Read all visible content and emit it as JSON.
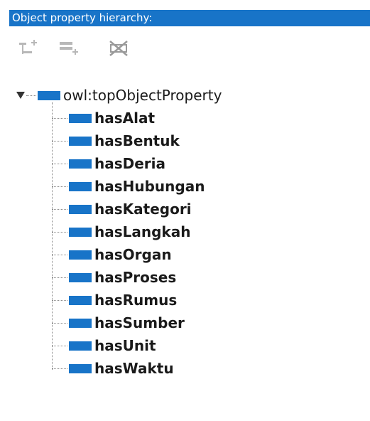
{
  "panel": {
    "title": "Object property hierarchy:"
  },
  "toolbar": {
    "buttons": [
      {
        "name": "add-sub-property",
        "icon": "add-subproperty-icon",
        "enabled": false
      },
      {
        "name": "add-sibling-property",
        "icon": "add-sibling-icon",
        "enabled": false
      },
      {
        "name": "delete-property",
        "icon": "delete-property-icon",
        "enabled": true
      }
    ]
  },
  "tree": {
    "root": {
      "label": "owl:topObjectProperty",
      "expanded": true
    },
    "children": [
      {
        "label": "hasAlat"
      },
      {
        "label": "hasBentuk"
      },
      {
        "label": "hasDeria"
      },
      {
        "label": "hasHubungan"
      },
      {
        "label": "hasKategori"
      },
      {
        "label": "hasLangkah"
      },
      {
        "label": "hasOrgan"
      },
      {
        "label": "hasProses"
      },
      {
        "label": "hasRumus"
      },
      {
        "label": "hasSumber"
      },
      {
        "label": "hasUnit"
      },
      {
        "label": "hasWaktu"
      }
    ]
  },
  "colors": {
    "accent": "#1874c8",
    "property_icon": "#1874c8",
    "disabled_icon": "#b8b8b8"
  }
}
